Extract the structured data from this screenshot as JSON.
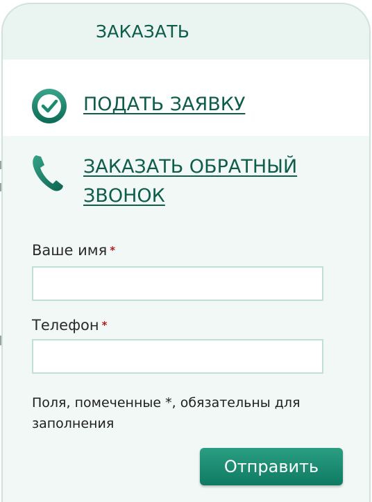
{
  "panel": {
    "title": "ЗАКАЗАТЬ"
  },
  "links": [
    {
      "label": "ПОДАТЬ ЗАЯВКУ",
      "icon": "check-circle-icon"
    },
    {
      "label": "ЗАКАЗАТЬ ОБРАТНЫЙ ЗВОНОК",
      "icon": "phone-icon"
    }
  ],
  "form": {
    "name_label": "Ваше имя",
    "name_value": "",
    "phone_label": "Телефон",
    "phone_value": "",
    "required_mark": "*",
    "note": "Поля, помеченные *, обязательны для заполнения",
    "submit_label": "Отправить"
  },
  "colors": {
    "accent": "#0e5c4a",
    "button": "#1a8a6f",
    "panel_bg": "#f2f8f6",
    "required": "#b21b1b"
  }
}
